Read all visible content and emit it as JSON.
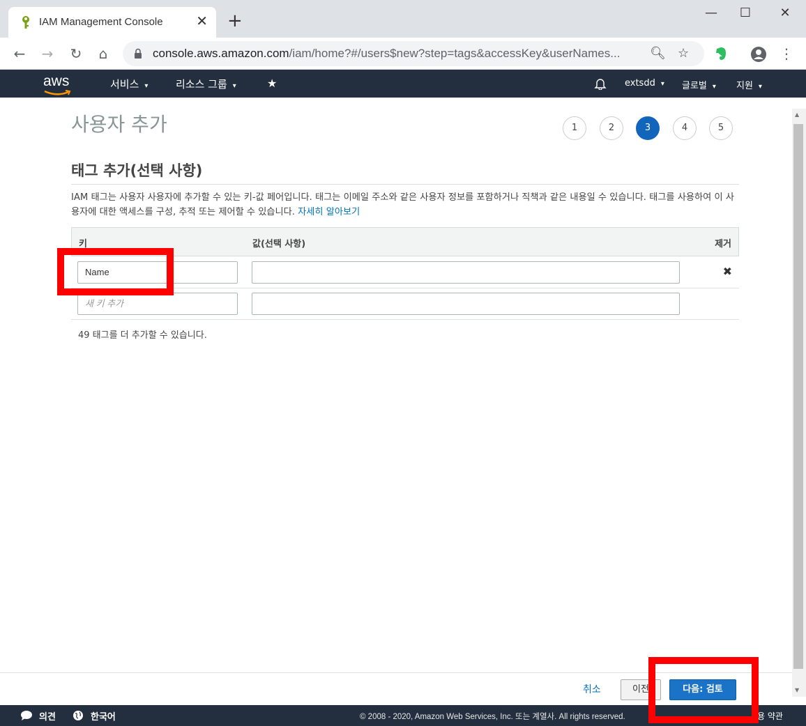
{
  "browser": {
    "tab_title": "IAM Management Console",
    "url_host": "console.aws.amazon.com",
    "url_path": "/iam/home?#/users$new?step=tags&accessKey&userNames..."
  },
  "aws_nav": {
    "logo": "aws",
    "services": "서비스",
    "resource_groups": "리소스 그룹",
    "account": "extsdd",
    "region": "글로벌",
    "support": "지원"
  },
  "page": {
    "title": "사용자 추가",
    "steps": [
      "1",
      "2",
      "3",
      "4",
      "5"
    ],
    "active_step": "3",
    "section_title": "태그 추가(선택 사항)",
    "description": "IAM 태그는 사용자 사용자에 추가할 수 있는 키-값 페어입니다. 태그는 이메일 주소와 같은 사용자 정보를 포함하거나 직책과 같은 내용일 수 있습니다. 태그를 사용하여 이 사용자에 대한 액세스를 구성, 추적 또는 제어할 수 있습니다.",
    "learn_more": "자세히 알아보기"
  },
  "table": {
    "col_key": "키",
    "col_value": "값(선택 사항)",
    "col_remove": "제거",
    "rows": [
      {
        "key": "Name",
        "value": ""
      }
    ],
    "new_key_placeholder": "새 키 추가",
    "tags_remaining": "49 태그를 더 추가할 수 있습니다."
  },
  "actions": {
    "cancel": "취소",
    "previous": "이전",
    "next": "다음: 검토"
  },
  "footer": {
    "feedback": "의견",
    "language": "한국어",
    "copyright": "© 2008 - 2020, Amazon Web Services, Inc. 또는 계열사. All rights reserved.",
    "terms": "용 약관"
  },
  "colors": {
    "aws_nav_bg": "#232f3e",
    "active_step": "#1166bb",
    "primary_button": "#1a73c7",
    "annotation": "#ff0000"
  }
}
